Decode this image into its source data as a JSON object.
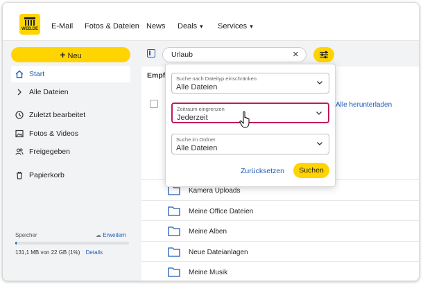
{
  "brand": {
    "logo_text": "WEB.DE",
    "accent": "#ffd400",
    "link_color": "#1c5bb5",
    "highlight_color": "#c2185b"
  },
  "topnav": {
    "items": [
      {
        "label": "E-Mail"
      },
      {
        "label": "Fotos & Dateien"
      },
      {
        "label": "News"
      },
      {
        "label": "Deals"
      },
      {
        "label": "Services"
      }
    ]
  },
  "sidebar": {
    "new_label": "Neu",
    "items": [
      {
        "label": "Start",
        "icon": "home-icon"
      },
      {
        "label": "Alle Dateien",
        "icon": "chevron-right-icon"
      },
      {
        "label": "Zuletzt bearbeitet",
        "icon": "clock-icon"
      },
      {
        "label": "Fotos & Videos",
        "icon": "image-icon"
      },
      {
        "label": "Freigegeben",
        "icon": "people-icon"
      },
      {
        "label": "Papierkorb",
        "icon": "trash-icon"
      }
    ],
    "storage": {
      "title": "Speicher",
      "upgrade_label": "Erweitern",
      "usage_text": "131,1 MB von 22 GB (1%)",
      "details_label": "Details",
      "used_percent": 1
    }
  },
  "search": {
    "value": "Urlaub"
  },
  "content": {
    "header": "Empf",
    "download_all": "Alle herunterladen",
    "folders": [
      {
        "name": "Kamera Uploads"
      },
      {
        "name": "Meine Office Dateien"
      },
      {
        "name": "Meine Alben"
      },
      {
        "name": "Neue Dateianlagen"
      },
      {
        "name": "Meine Musik"
      }
    ]
  },
  "filter_panel": {
    "filetype": {
      "label": "Suche nach Dateityp einschränken",
      "value": "Alle Dateien"
    },
    "timerange": {
      "label": "Zeitraum eingrenzen",
      "value": "Jederzeit"
    },
    "folder": {
      "label": "Suche im Ordner",
      "value": "Alle Dateien"
    },
    "reset_label": "Zurücksetzen",
    "search_label": "Suchen"
  }
}
